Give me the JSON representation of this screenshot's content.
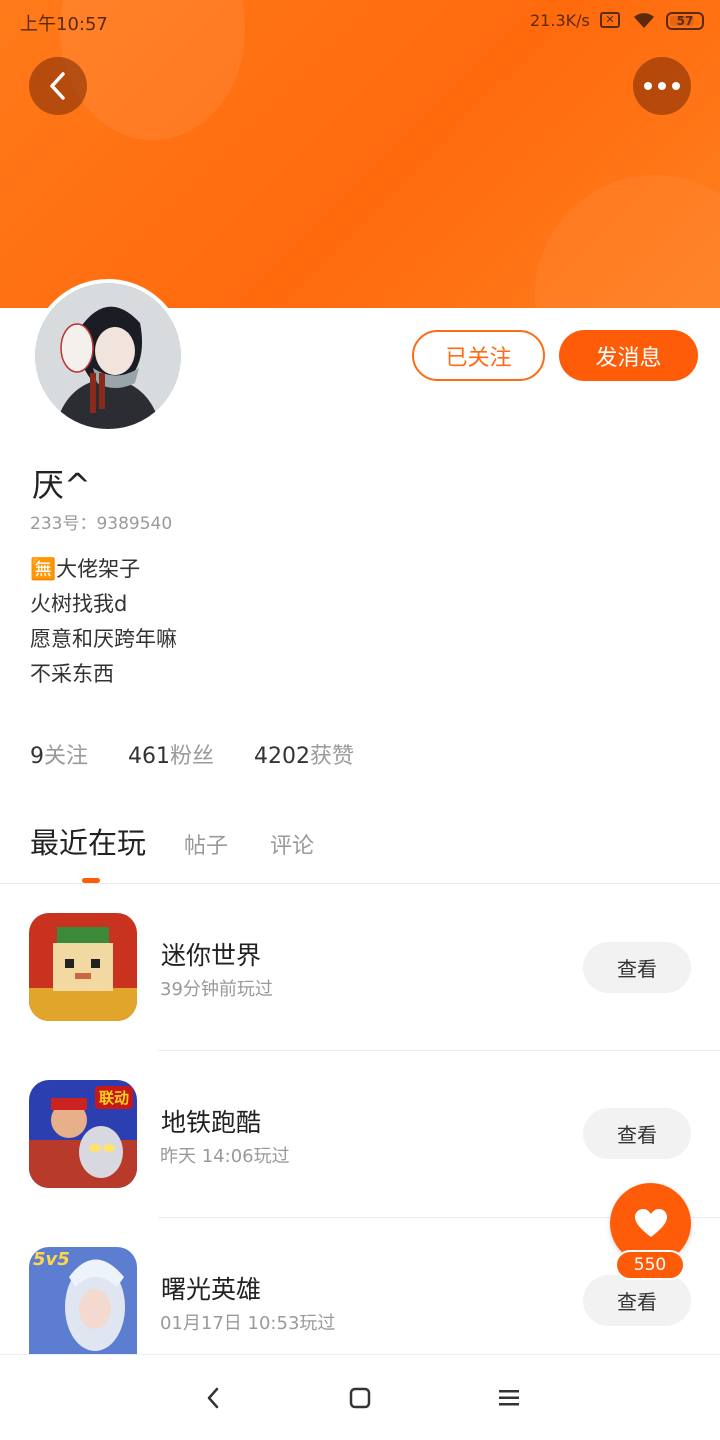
{
  "status_bar": {
    "time": "上午10:57",
    "net_speed": "21.3K/s",
    "sim_mark": "✕",
    "battery": "57"
  },
  "header": {
    "back_icon": "chevron-left-icon",
    "more_icon": "more-dots-icon"
  },
  "profile": {
    "follow_label": "已关注",
    "message_label": "发消息",
    "name": "厌^",
    "id_text": "233号：9389540",
    "bio": [
      "🈚大佬架子",
      "火树找我d",
      "愿意和厌跨年嘛",
      "不采东西"
    ]
  },
  "stats": [
    {
      "value": "9",
      "label": "关注"
    },
    {
      "value": "461",
      "label": "粉丝"
    },
    {
      "value": "4202",
      "label": "获赞"
    }
  ],
  "tabs": [
    {
      "label": "最近在玩",
      "active": true
    },
    {
      "label": "帖子",
      "active": false
    },
    {
      "label": "评论",
      "active": false
    }
  ],
  "games": [
    {
      "name": "迷你世界",
      "time": "39分钟前玩过",
      "action": "查看"
    },
    {
      "name": "地铁跑酷",
      "time": "昨天 14:06玩过",
      "action": "查看",
      "badge": "联动"
    },
    {
      "name": "曙光英雄",
      "time": "01月17日 10:53玩过",
      "action": "查看",
      "badge": "5v5"
    }
  ],
  "like": {
    "count": "550",
    "icon": "heart-icon"
  },
  "colors": {
    "accent": "#ff5c0a",
    "header": "#ff7a1a"
  }
}
